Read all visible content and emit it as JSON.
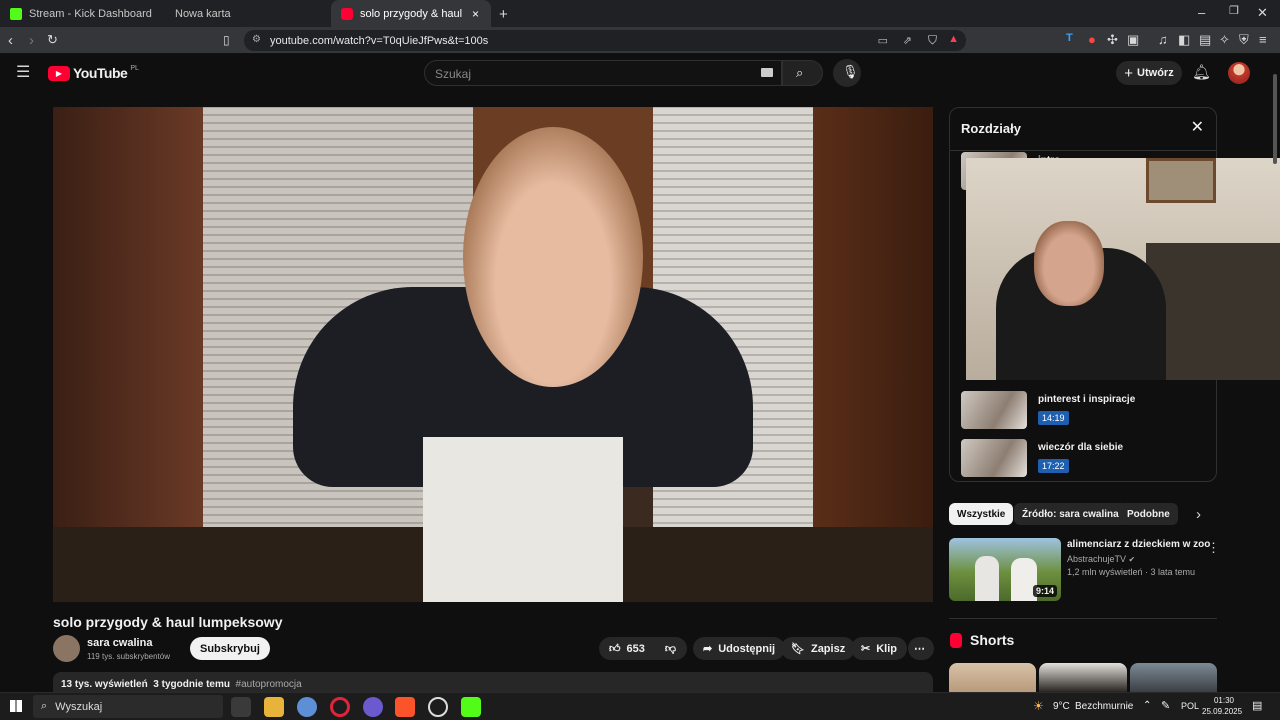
{
  "browser": {
    "tabs": [
      {
        "label": "Stream - Kick Dashboard"
      },
      {
        "label": "Nowa karta"
      },
      {
        "label": "solo przygody & haul lumpek"
      }
    ],
    "url": "youtube.com/watch?v=T0qUieJfPws&t=100s"
  },
  "youtube": {
    "logo": "YouTube",
    "region": "PL",
    "search_placeholder": "Szukaj",
    "create_label": "Utwórz",
    "video": {
      "title": "solo przygody & haul lumpeksowy",
      "channel": "sara cwalina",
      "subscribers": "119 tys. subskrybentów",
      "subscribe_label": "Subskrybuj",
      "likes": "653",
      "share_label": "Udostępnij",
      "save_label": "Zapisz",
      "clip_label": "Klip",
      "views": "13 tys. wyświetleń",
      "age": "3 tygodnie temu",
      "tag": "#autopromocja"
    },
    "chapters": {
      "title": "Rozdziały",
      "items": [
        {
          "name": "intro",
          "time": ""
        },
        {
          "name": "pinterest i inspiracje",
          "time": "14:19"
        },
        {
          "name": "wieczór dla siebie",
          "time": "17:22"
        }
      ]
    },
    "filters": [
      "Wszystkie",
      "Źródło: sara cwalina",
      "Podobne"
    ],
    "recommended": {
      "title": "alimenciarz z dzieckiem w zoo",
      "channel": "AbstrachujeTV",
      "meta": "1,2 mln wyświetleń · 3 lata temu",
      "duration": "9:14"
    },
    "shorts_label": "Shorts"
  },
  "taskbar": {
    "search": "Wyszukaj",
    "weather": "9°C",
    "weather_desc": "Bezchmurnie",
    "lang": "POL",
    "time": "01:30",
    "date": "25.09.2025"
  }
}
